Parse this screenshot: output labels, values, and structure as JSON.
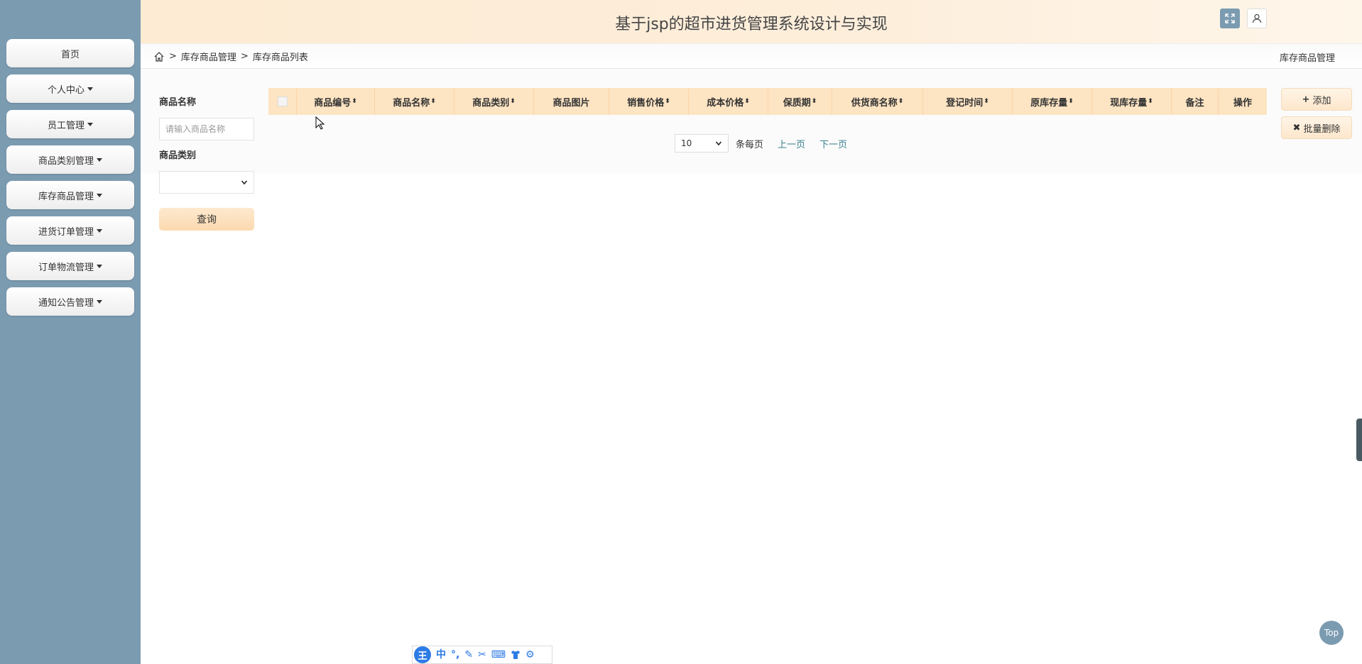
{
  "header": {
    "title": "基于jsp的超市进货管理系统设计与实现"
  },
  "sidebar": {
    "items": [
      {
        "label": "首页",
        "dropdown": false
      },
      {
        "label": "个人中心",
        "dropdown": true
      },
      {
        "label": "员工管理",
        "dropdown": true
      },
      {
        "label": "商品类别管理",
        "dropdown": true
      },
      {
        "label": "库存商品管理",
        "dropdown": true
      },
      {
        "label": "进货订单管理",
        "dropdown": true
      },
      {
        "label": "订单物流管理",
        "dropdown": true
      },
      {
        "label": "通知公告管理",
        "dropdown": true
      }
    ]
  },
  "breadcrumb": {
    "level1": "库存商品管理",
    "level2": "库存商品列表",
    "separator": ">",
    "right_title": "库存商品管理"
  },
  "filters": {
    "name_label": "商品名称",
    "name_placeholder": "请输入商品名称",
    "category_label": "商品类别",
    "query_button": "查询"
  },
  "table": {
    "columns": [
      {
        "label": "商品编号",
        "sortable": true
      },
      {
        "label": "商品名称",
        "sortable": true
      },
      {
        "label": "商品类别",
        "sortable": true
      },
      {
        "label": "商品图片",
        "sortable": false
      },
      {
        "label": "销售价格",
        "sortable": true
      },
      {
        "label": "成本价格",
        "sortable": true
      },
      {
        "label": "保质期",
        "sortable": true
      },
      {
        "label": "供货商名称",
        "sortable": true
      },
      {
        "label": "登记时间",
        "sortable": true
      },
      {
        "label": "原库存量",
        "sortable": true
      },
      {
        "label": "现库存量",
        "sortable": true
      },
      {
        "label": "备注",
        "sortable": false
      },
      {
        "label": "操作",
        "sortable": false
      }
    ],
    "rows": []
  },
  "pagination": {
    "page_size": "10",
    "per_page_text": "条每页",
    "prev": "上一页",
    "next": "下一页"
  },
  "actions": {
    "add": "添加",
    "batch_delete": "批量删除"
  },
  "ime_toolbar": {
    "logo": "王",
    "mode": "中",
    "punct": "°,"
  },
  "top_button": "Top",
  "colors": {
    "sidebar": "#7b9bb1",
    "table_header": "#fde4c3",
    "link": "#3a7f8f"
  }
}
